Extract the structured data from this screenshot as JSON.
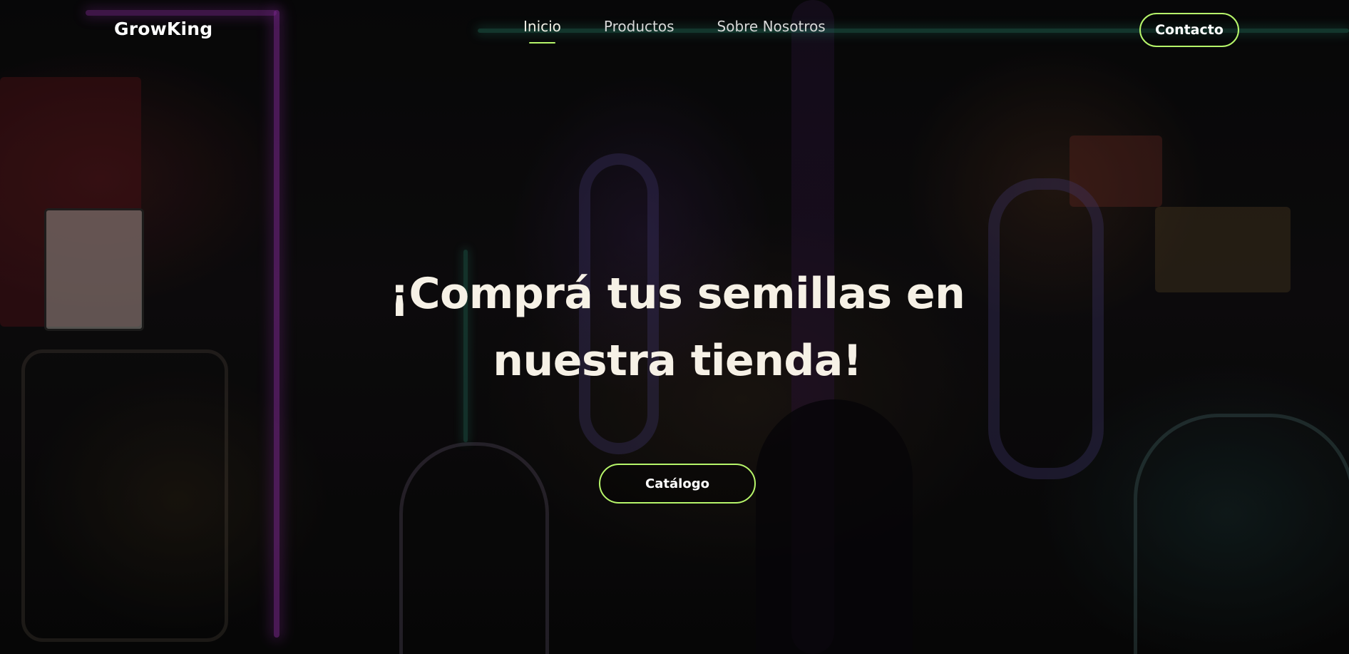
{
  "brand": {
    "name": "GrowKing"
  },
  "nav": {
    "items": [
      {
        "label": "Inicio",
        "active": true
      },
      {
        "label": "Productos",
        "active": false
      },
      {
        "label": "Sobre Nosotros",
        "active": false
      }
    ],
    "contact_label": "Contacto"
  },
  "hero": {
    "title": "¡Comprá tus semillas en nuestra tienda!",
    "cta_label": "Catálogo",
    "background_image": "shop-interior-photo"
  },
  "colors": {
    "accent": "#b6f56a",
    "title_text": "#f6f1e6",
    "background": "#070707"
  }
}
